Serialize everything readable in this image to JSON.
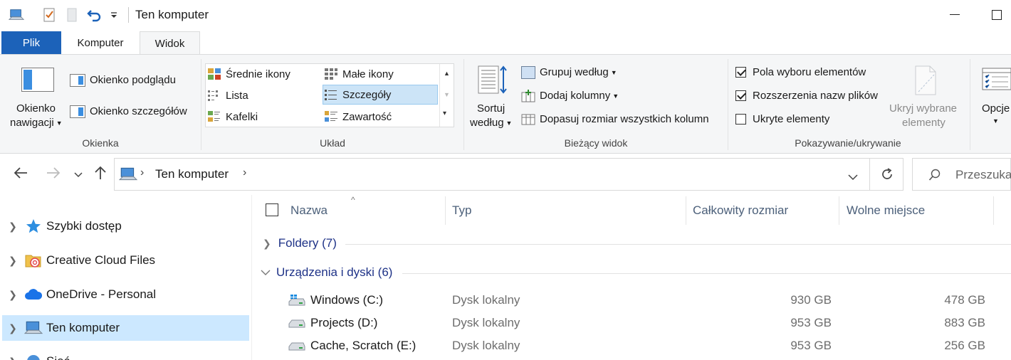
{
  "window": {
    "title": "Ten komputer"
  },
  "tabs": [
    {
      "label": "Plik"
    },
    {
      "label": "Komputer"
    },
    {
      "label": "Widok"
    }
  ],
  "ribbon": {
    "panes": {
      "nav_label_1": "Okienko",
      "nav_label_2": "nawigacji",
      "preview": "Okienko podglądu",
      "details": "Okienko szczegółów",
      "group": "Okienka"
    },
    "layout": {
      "items": [
        "Średnie ikony",
        "Małe ikony",
        "Lista",
        "Szczegóły",
        "Kafelki",
        "Zawartość"
      ],
      "selected": "Szczegóły",
      "group": "Układ"
    },
    "current_view": {
      "sort_1": "Sortuj",
      "sort_2": "według",
      "group_by": "Grupuj według",
      "add_columns": "Dodaj kolumny",
      "fit_columns": "Dopasuj rozmiar wszystkich kolumn",
      "group": "Bieżący widok"
    },
    "show_hide": {
      "item_checkboxes": "Pola wyboru elementów",
      "item_checkboxes_checked": true,
      "extensions": "Rozszerzenia nazw plików",
      "extensions_checked": true,
      "hidden": "Ukryte elementy",
      "hidden_checked": false,
      "hide_selected_1": "Ukryj wybrane",
      "hide_selected_2": "elementy",
      "group": "Pokazywanie/ukrywanie"
    },
    "options": {
      "label": "Opcje"
    }
  },
  "address": {
    "path": "Ten komputer",
    "search_placeholder": "Przeszukaj"
  },
  "nav": {
    "items": [
      {
        "label": "Szybki dostęp",
        "icon": "star-icon"
      },
      {
        "label": "Creative Cloud Files",
        "icon": "creative-cloud-folder-icon"
      },
      {
        "label": "OneDrive - Personal",
        "icon": "onedrive-cloud-icon"
      },
      {
        "label": "Ten komputer",
        "icon": "computer-icon"
      },
      {
        "label": "Sieć",
        "icon": "network-icon"
      }
    ],
    "selected": "Ten komputer"
  },
  "columns": {
    "name": "Nazwa",
    "type": "Typ",
    "total": "Całkowity rozmiar",
    "free": "Wolne miejsce"
  },
  "groups": {
    "folders": "Foldery (7)",
    "devices": "Urządzenia i dyski (6)"
  },
  "drives": [
    {
      "name": "Windows (C:)",
      "type": "Dysk lokalny",
      "total": "930 GB",
      "free": "478 GB"
    },
    {
      "name": "Projects (D:)",
      "type": "Dysk lokalny",
      "total": "953 GB",
      "free": "883 GB"
    },
    {
      "name": "Cache, Scratch (E:)",
      "type": "Dysk lokalny",
      "total": "953 GB",
      "free": "256 GB"
    }
  ],
  "colors": {
    "accent": "#1c62b9",
    "selected_bg": "#cce8ff",
    "group_text": "#1e3287"
  }
}
